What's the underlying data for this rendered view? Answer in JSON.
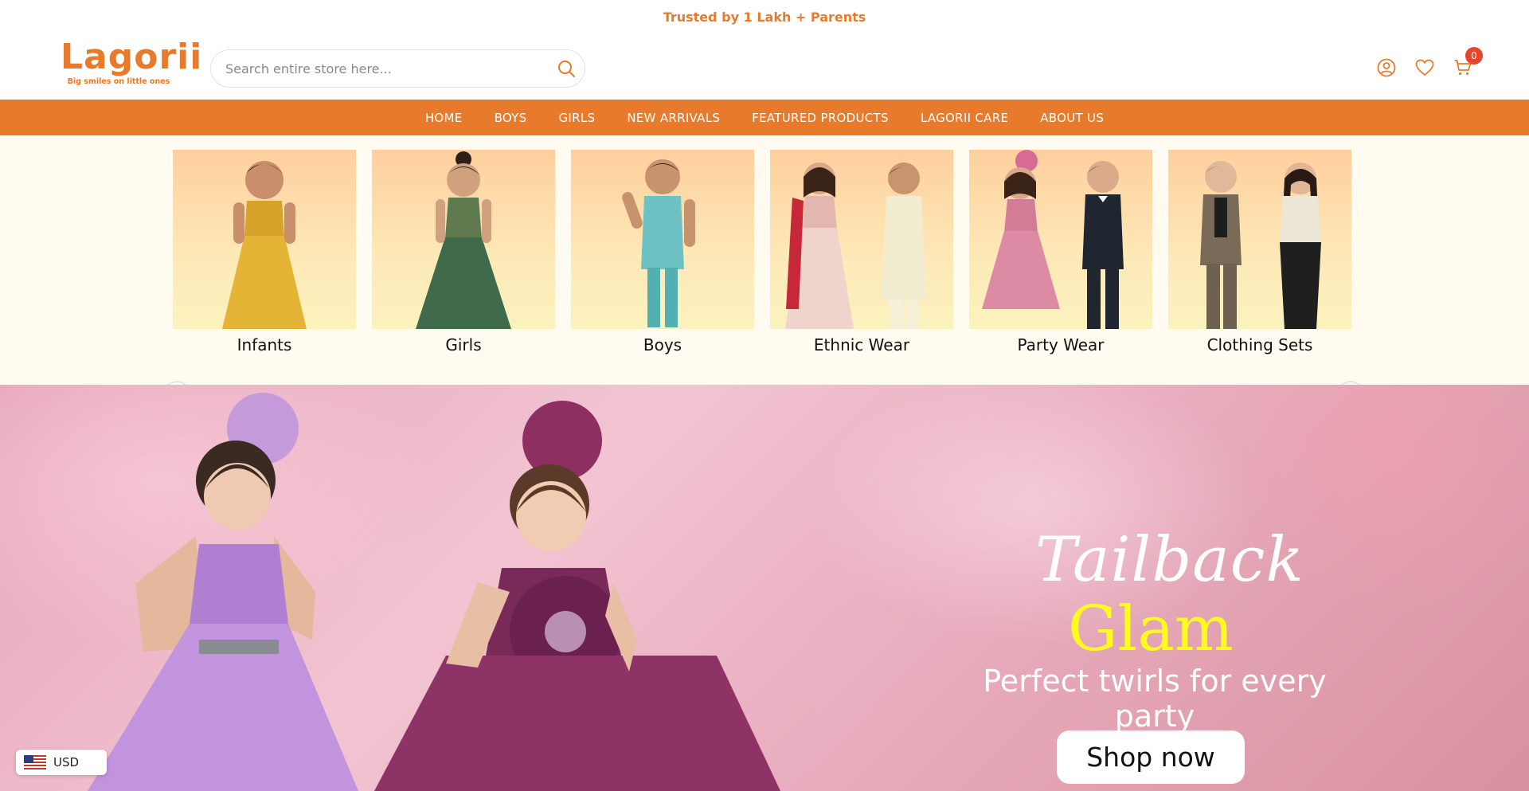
{
  "announcement": "Trusted by 1 Lakh + Parents",
  "header": {
    "logo_text": "Lagorii",
    "logo_tagline": "Big smiles on little ones",
    "search_placeholder": "Search entire store here...",
    "cart_count": "0"
  },
  "nav": {
    "items": [
      "HOME",
      "BOYS",
      "GIRLS",
      "NEW ARRIVALS",
      "FEATURED PRODUCTS",
      "LAGORII CARE",
      "ABOUT US"
    ]
  },
  "categories": [
    {
      "label": "Infants"
    },
    {
      "label": "Girls"
    },
    {
      "label": "Boys"
    },
    {
      "label": "Ethnic Wear"
    },
    {
      "label": "Party Wear"
    },
    {
      "label": "Clothing Sets"
    }
  ],
  "hero": {
    "title_line1": "Tailback",
    "title_line2": "Glam",
    "subtitle": "Perfect twirls for every party",
    "cta": "Shop now"
  },
  "currency": {
    "code": "USD"
  },
  "colors": {
    "brand_orange": "#e87a2c",
    "hero_yellow": "#fffb1f",
    "badge_red": "#e8432c"
  }
}
